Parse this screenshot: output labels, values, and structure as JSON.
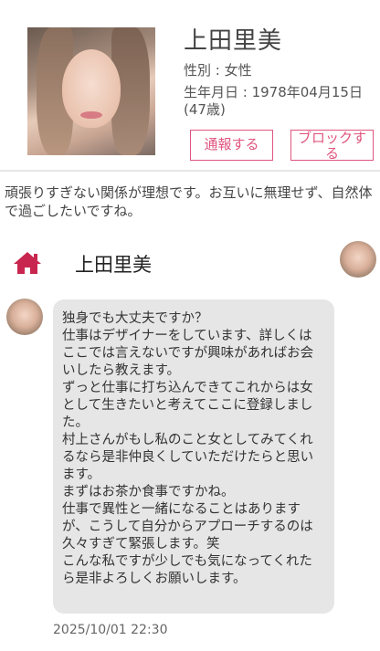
{
  "profile": {
    "name": "上田里美",
    "gender": "性別 : 女性",
    "birth": "生年月日 : 1978年04月15日(47歳)",
    "report_label": "通報する",
    "block_label": "ブロックする"
  },
  "bio": "頑張りすぎない関係が理想です。お互いに無理せず、自然体で過ごしたいですね。",
  "chat": {
    "title": "上田里美",
    "messages": [
      {
        "text": "独身でも大丈夫ですか？\n仕事はデザイナーをしています、詳しくはここでは言えないですが興味があればお会いしたら教えます。\nずっと仕事に打ち込んできてこれからは女として生きたいと考えてここに登録しました。\n村上さんがもし私のこと女としてみてくれるなら是非仲良くしていただけたらと思います。\nまずはお茶か食事ですかね。\n仕事で異性と一緒になることはありますが、こうして自分からアプローチするのは久々すぎて緊張します。笑\nこんな私ですが少しでも気になってくれたら是非よろしくお願いします。",
        "timestamp": "2025/10/01 22:30"
      }
    ]
  },
  "colors": {
    "accent": "#e0557f",
    "home_icon": "#c8264f",
    "bubble": "#e6e6e6"
  }
}
